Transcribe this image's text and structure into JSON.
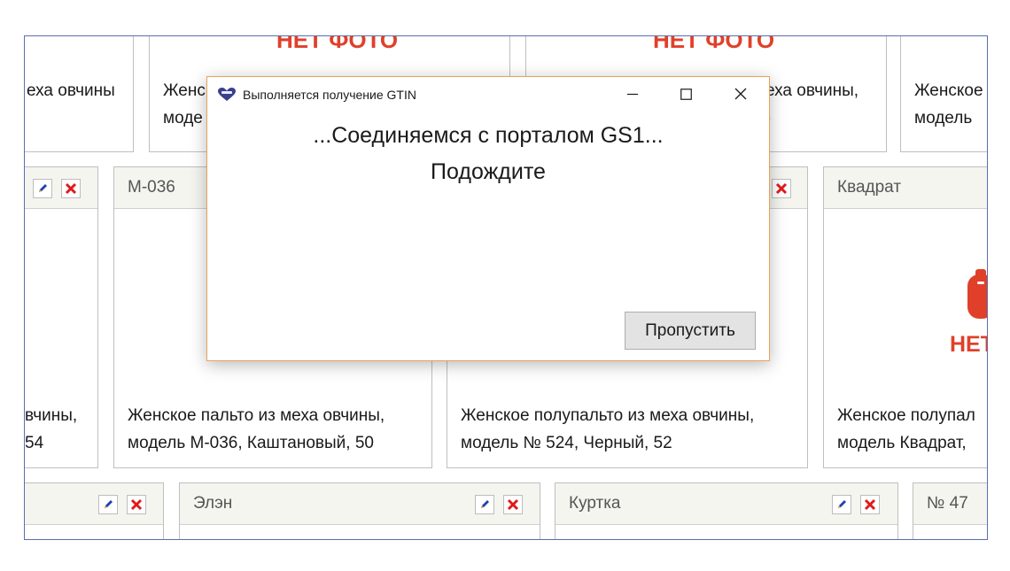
{
  "dialog": {
    "title": "Выполняется получение GTIN",
    "message_line1": "...Соединяемся с порталом GS1...",
    "message_line2": "Подождите",
    "skip_label": "Пропустить"
  },
  "background": {
    "missing_photo_label": "НЕТ ФОТО",
    "missing_photo_label_short": "НЕТ",
    "row1": [
      {
        "desc_line1": "еха овчины",
        "desc_line2": ""
      },
      {
        "desc_line1": "Женс",
        "desc_line2": "моде"
      },
      {
        "desc_line1": "еха овчины,",
        "desc_line2": ")"
      },
      {
        "desc_line1": "Женское",
        "desc_line2": "модель"
      }
    ],
    "row2": [
      {
        "title": "",
        "desc_line1": "вчины,",
        "desc_line2": "54"
      },
      {
        "title": "М-036",
        "desc_line1": "Женское пальто из меха овчины,",
        "desc_line2": "модель М-036, Каштановый, 50"
      },
      {
        "title": "",
        "desc_line1": "Женское полупальто из меха овчины,",
        "desc_line2": "модель № 524, Черный, 52"
      },
      {
        "title": "Квадрат",
        "desc_line1": "Женское полупал",
        "desc_line2": "модель Квадрат,"
      }
    ],
    "row3": [
      {
        "title": ""
      },
      {
        "title": "Элэн"
      },
      {
        "title": "Куртка"
      },
      {
        "title": "№ 47"
      }
    ]
  },
  "colors": {
    "accent_red": "#e0402a",
    "dialog_border": "#e6a35a",
    "viewport_border": "#5a6fb0"
  },
  "icons": [
    "app-heart-icon",
    "minimize-icon",
    "maximize-icon",
    "close-icon",
    "edit-pencil-icon",
    "delete-x-icon",
    "no-photo-placeholder-icon"
  ]
}
